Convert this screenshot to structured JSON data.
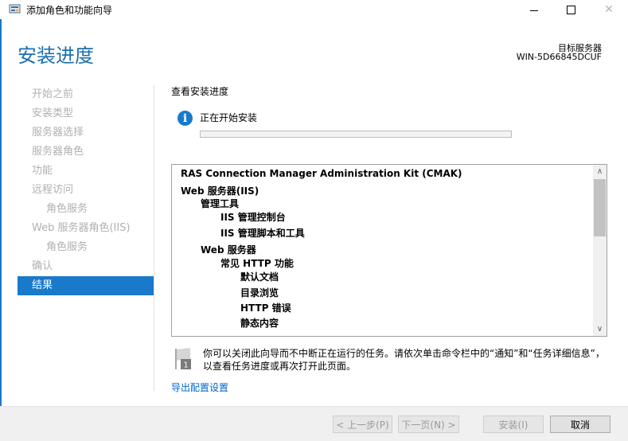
{
  "window": {
    "title": "添加角色和功能向导",
    "close_glyph": "✕"
  },
  "header": {
    "page_title": "安装进度",
    "target_label": "目标服务器",
    "target_name": "WIN-5D66845DCUF"
  },
  "nav": {
    "items": [
      {
        "label": "开始之前",
        "state": "disabled",
        "level": 0
      },
      {
        "label": "安装类型",
        "state": "disabled",
        "level": 0
      },
      {
        "label": "服务器选择",
        "state": "disabled",
        "level": 0
      },
      {
        "label": "服务器角色",
        "state": "disabled",
        "level": 0
      },
      {
        "label": "功能",
        "state": "disabled",
        "level": 0
      },
      {
        "label": "远程访问",
        "state": "disabled",
        "level": 0
      },
      {
        "label": "角色服务",
        "state": "disabled",
        "level": 1
      },
      {
        "label": "Web 服务器角色(IIS)",
        "state": "disabled",
        "level": 0
      },
      {
        "label": "角色服务",
        "state": "disabled",
        "level": 1
      },
      {
        "label": "确认",
        "state": "disabled",
        "level": 0
      },
      {
        "label": "结果",
        "state": "active",
        "level": 0
      }
    ]
  },
  "main": {
    "section_title": "查看安装进度",
    "status_icon": "info-icon",
    "status_text": "正在开始安装",
    "progress_value": 0,
    "results": [
      {
        "text": "RAS Connection Manager Administration Kit (CMAK)",
        "level": 0
      },
      {
        "text": "Web 服务器(IIS)",
        "level": 0
      },
      {
        "text": "管理工具",
        "level": 1
      },
      {
        "text": "IIS 管理控制台",
        "level": 2
      },
      {
        "text": "IIS 管理脚本和工具",
        "level": 2
      },
      {
        "text": "Web 服务器",
        "level": 1
      },
      {
        "text": "常见 HTTP 功能",
        "level": 2
      },
      {
        "text": "默认文档",
        "level": 3
      },
      {
        "text": "目录浏览",
        "level": 3
      },
      {
        "text": "HTTP 错误",
        "level": 3
      },
      {
        "text": "静态内容",
        "level": 3
      }
    ],
    "note_text": "你可以关闭此向导而不中断正在运行的任务。请依次单击命令栏中的“通知”和“任务详细信息”，以查看任务进度或再次打开此页面。",
    "note_badge": "1",
    "export_link": "导出配置设置"
  },
  "footer": {
    "prev_label": "< 上一步(P)",
    "next_label": "下一页(N) >",
    "install_label": "安装(I)",
    "cancel_label": "取消"
  },
  "colors": {
    "accent": "#1979ca",
    "link": "#0066cc",
    "disabled_text": "#b0b0b0"
  }
}
